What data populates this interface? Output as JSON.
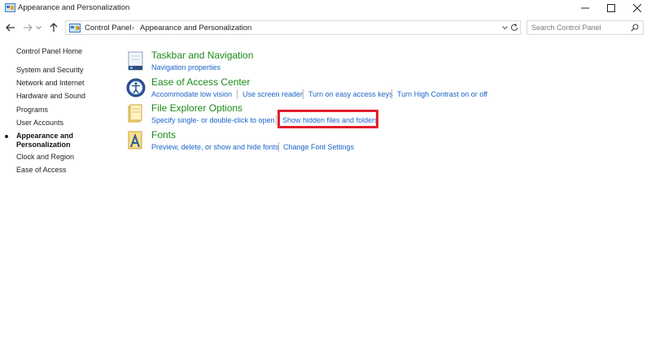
{
  "window": {
    "title": "Appearance and Personalization",
    "controls": [
      "minimize-icon",
      "maximize-icon",
      "close-icon"
    ]
  },
  "address": {
    "breadcrumbs": [
      "Control Panel",
      "Appearance and Personalization"
    ],
    "search_placeholder": "Search Control Panel"
  },
  "sidebar": {
    "home": "Control Panel Home",
    "items": [
      "System and Security",
      "Network and Internet",
      "Hardware and Sound",
      "Programs",
      "User Accounts",
      "Appearance and Personalization",
      "Clock and Region",
      "Ease of Access"
    ],
    "active_index": 5
  },
  "categories": [
    {
      "title": "Taskbar and Navigation",
      "icon": "taskbar-icon",
      "links": [
        "Navigation properties"
      ]
    },
    {
      "title": "Ease of Access Center",
      "icon": "ease-of-access-icon",
      "links": [
        "Accommodate low vision",
        "Use screen reader",
        "Turn on easy access keys",
        "Turn High Contrast on or off"
      ]
    },
    {
      "title": "File Explorer Options",
      "icon": "folder-options-icon",
      "links": [
        "Specify single- or double-click to open",
        "Show hidden files and folders"
      ]
    },
    {
      "title": "Fonts",
      "icon": "fonts-icon",
      "links": [
        "Preview, delete, or show and hide fonts",
        "Change Font Settings"
      ]
    }
  ],
  "colors": {
    "category_title": "#1a8a1a",
    "link": "#1a64c8",
    "highlight_box": "#e01f2c"
  }
}
